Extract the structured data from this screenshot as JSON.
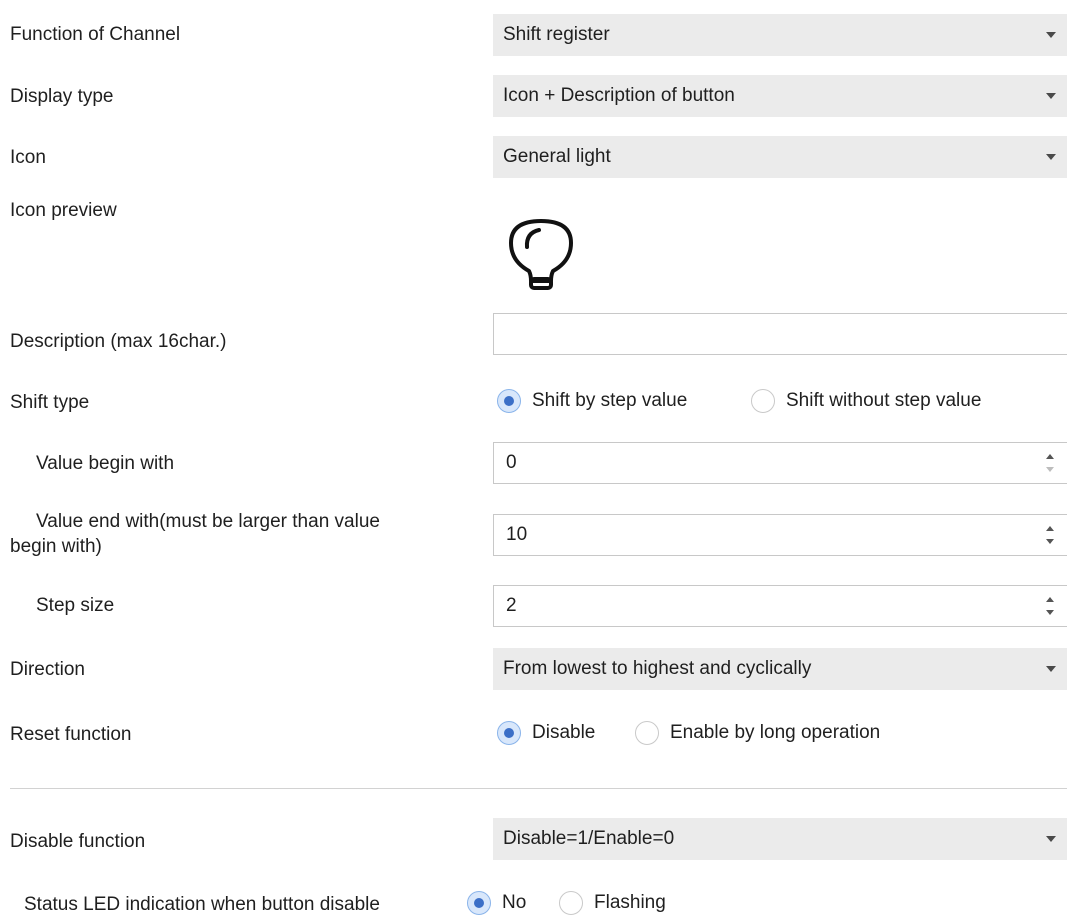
{
  "settings": {
    "function_of_channel": {
      "label": "Function of Channel",
      "value": "Shift register"
    },
    "display_type": {
      "label": "Display type",
      "value": "Icon + Description of button"
    },
    "icon": {
      "label": "Icon",
      "value": "General light"
    },
    "icon_preview": {
      "label": "Icon preview",
      "icon": "lightbulb-icon"
    },
    "description": {
      "label": "Description (max 16char.)",
      "value": ""
    },
    "shift_type": {
      "label": "Shift type",
      "options": [
        "Shift by step value",
        "Shift without step value"
      ],
      "selected": "Shift by step value"
    },
    "value_begin": {
      "label": "Value begin with",
      "value": "0"
    },
    "value_end": {
      "label_line1": "Value end with(must be larger than value",
      "label_line2": "begin with)",
      "value": "10"
    },
    "step_size": {
      "label": "Step  size",
      "value": "2"
    },
    "direction": {
      "label": "Direction",
      "value": "From lowest to highest and cyclically"
    },
    "reset_function": {
      "label": "Reset function",
      "options": [
        "Disable",
        "Enable by long operation"
      ],
      "selected": "Disable"
    },
    "disable_function": {
      "label": "Disable function",
      "value": "Disable=1/Enable=0"
    },
    "status_led": {
      "label": "Status LED indication when button disable",
      "options": [
        "No",
        "Flashing"
      ],
      "selected": "No"
    }
  },
  "colors": {
    "dropdown_bg": "#ebebeb",
    "radio_accent": "#3b6fc7",
    "divider": "#d2d2d2"
  }
}
